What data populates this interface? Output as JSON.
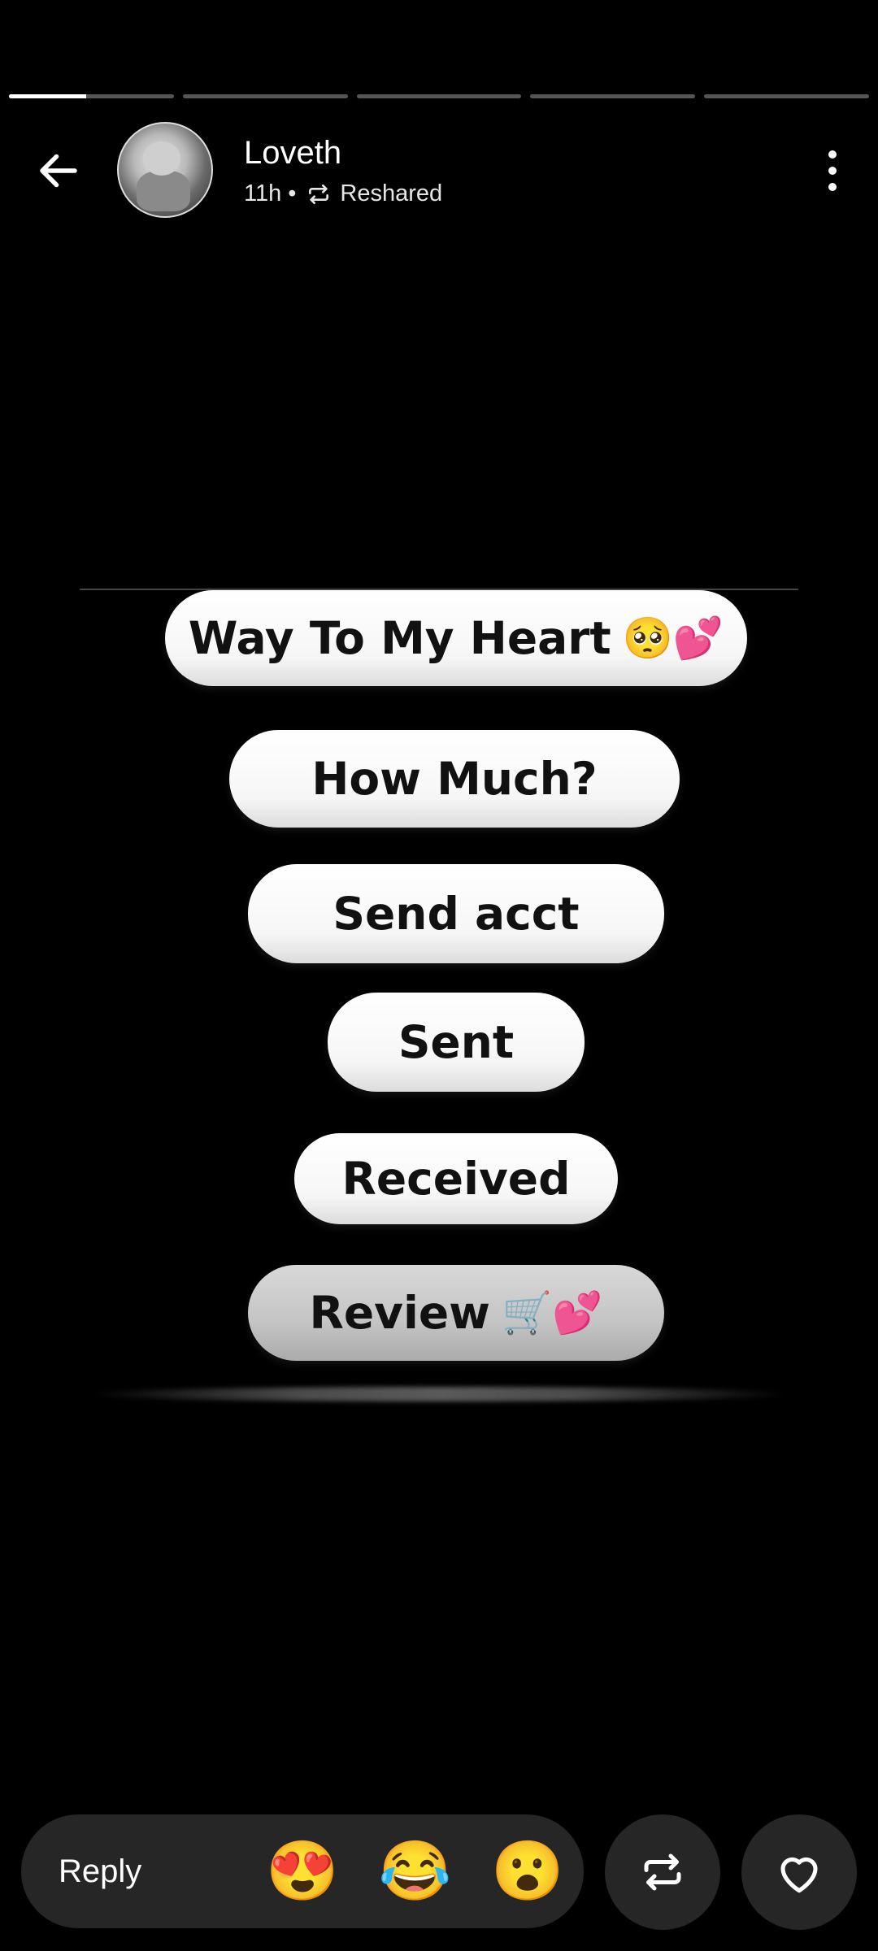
{
  "progress": {
    "segments": [
      {
        "fill": 0.47
      },
      {
        "fill": 0
      },
      {
        "fill": 0
      },
      {
        "fill": 0
      },
      {
        "fill": 0
      }
    ]
  },
  "header": {
    "user_name": "Loveth",
    "time": "11h",
    "separator": "•",
    "reshared_label": "Reshared"
  },
  "story": {
    "pills": [
      {
        "text": "Way To My Heart",
        "emoji": "🥺💕"
      },
      {
        "text": "How Much?",
        "emoji": ""
      },
      {
        "text": "Send acct",
        "emoji": ""
      },
      {
        "text": "Sent",
        "emoji": ""
      },
      {
        "text": "Received",
        "emoji": ""
      },
      {
        "text": "Review",
        "emoji": "🛒💕"
      }
    ]
  },
  "bottom": {
    "reply_label": "Reply",
    "reactions": [
      "😍",
      "😂",
      "😮"
    ]
  },
  "colors": {
    "background": "#000000",
    "bar_bg": "#262626"
  }
}
